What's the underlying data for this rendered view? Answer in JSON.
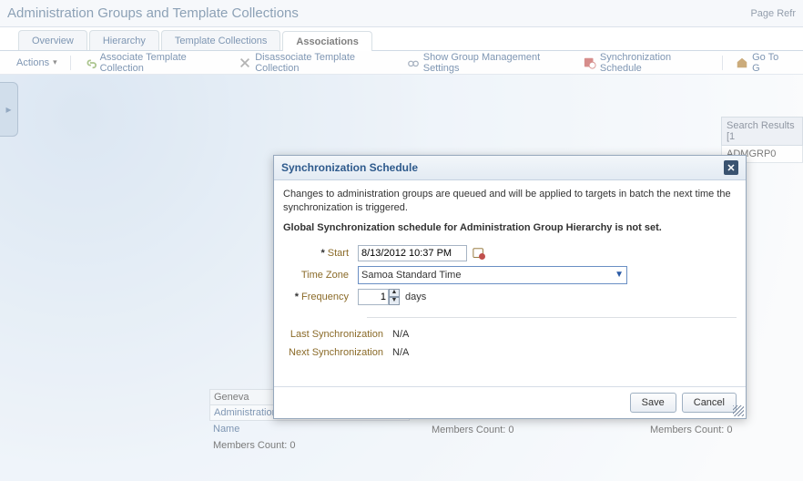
{
  "header": {
    "title": "Administration Groups and Template Collections",
    "refresh": "Page Refr"
  },
  "tabs": [
    {
      "label": "Overview"
    },
    {
      "label": "Hierarchy"
    },
    {
      "label": "Template Collections"
    },
    {
      "label": "Associations",
      "active": true
    }
  ],
  "toolbar": {
    "actions": "Actions",
    "associate": "Associate Template Collection",
    "disassociate": "Disassociate Template Collection",
    "show_settings": "Show Group Management Settings",
    "sync_schedule": "Synchronization Schedule",
    "goto": "Go To G"
  },
  "side": {
    "search_header": "Search Results [1",
    "row1": "ADMGRP0"
  },
  "cards": {
    "title": "Geneva",
    "subtitle": "Administration G",
    "name_label": "Name",
    "members_label": "Members Count:",
    "members_value": "0"
  },
  "dialog": {
    "title": "Synchronization Schedule",
    "desc": "Changes to administration groups are queued and will be applied to targets in batch the next time the synchronization is triggered.",
    "strong": "Global Synchronization schedule for Administration Group Hierarchy is not set.",
    "start_label": "Start",
    "start_value": "8/13/2012 10:37 PM",
    "tz_label": "Time Zone",
    "tz_value": "Samoa Standard Time",
    "freq_label": "Frequency",
    "freq_value": "1",
    "freq_unit": "days",
    "last_label": "Last Synchronization",
    "last_value": "N/A",
    "next_label": "Next Synchronization",
    "next_value": "N/A",
    "save": "Save",
    "cancel": "Cancel"
  }
}
